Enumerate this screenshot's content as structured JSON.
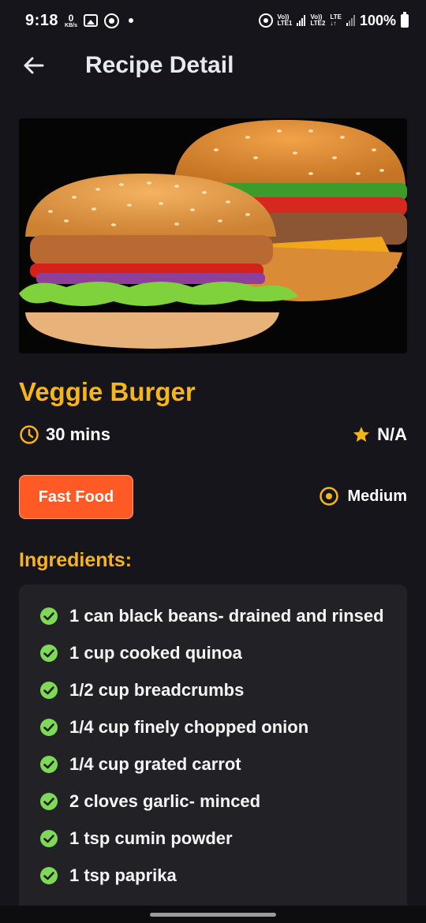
{
  "status_bar": {
    "time": "9:18",
    "net_speed_value": "0",
    "net_speed_unit": "KB/s",
    "sim1_label_top": "Vo))",
    "sim1_label_bottom": "LTE1",
    "sim2_label_top": "Vo))",
    "sim2_label_bottom": "LTE2",
    "lte_label": "LTE",
    "battery": "100%"
  },
  "header": {
    "title": "Recipe Detail"
  },
  "recipe": {
    "title": "Veggie Burger",
    "time": "30 mins",
    "rating": "N/A",
    "category": "Fast Food",
    "difficulty": "Medium"
  },
  "ingredients": {
    "header": "Ingredients:",
    "items": [
      "1 can black beans- drained and rinsed",
      "1 cup cooked quinoa",
      "1/2 cup breadcrumbs",
      "1/4 cup finely chopped onion",
      "1/4 cup grated carrot",
      "2 cloves garlic- minced",
      "1 tsp cumin powder",
      "1 tsp paprika"
    ]
  },
  "colors": {
    "accent": "#f6b51b",
    "chip": "#ff5a26",
    "check": "#7ed957",
    "background": "#16151b",
    "card": "#222226"
  },
  "icons": {
    "back": "arrow-left-icon",
    "time": "clock-icon",
    "rating": "star-icon",
    "difficulty": "radio-target-icon",
    "ingredient": "check-circle-icon"
  }
}
